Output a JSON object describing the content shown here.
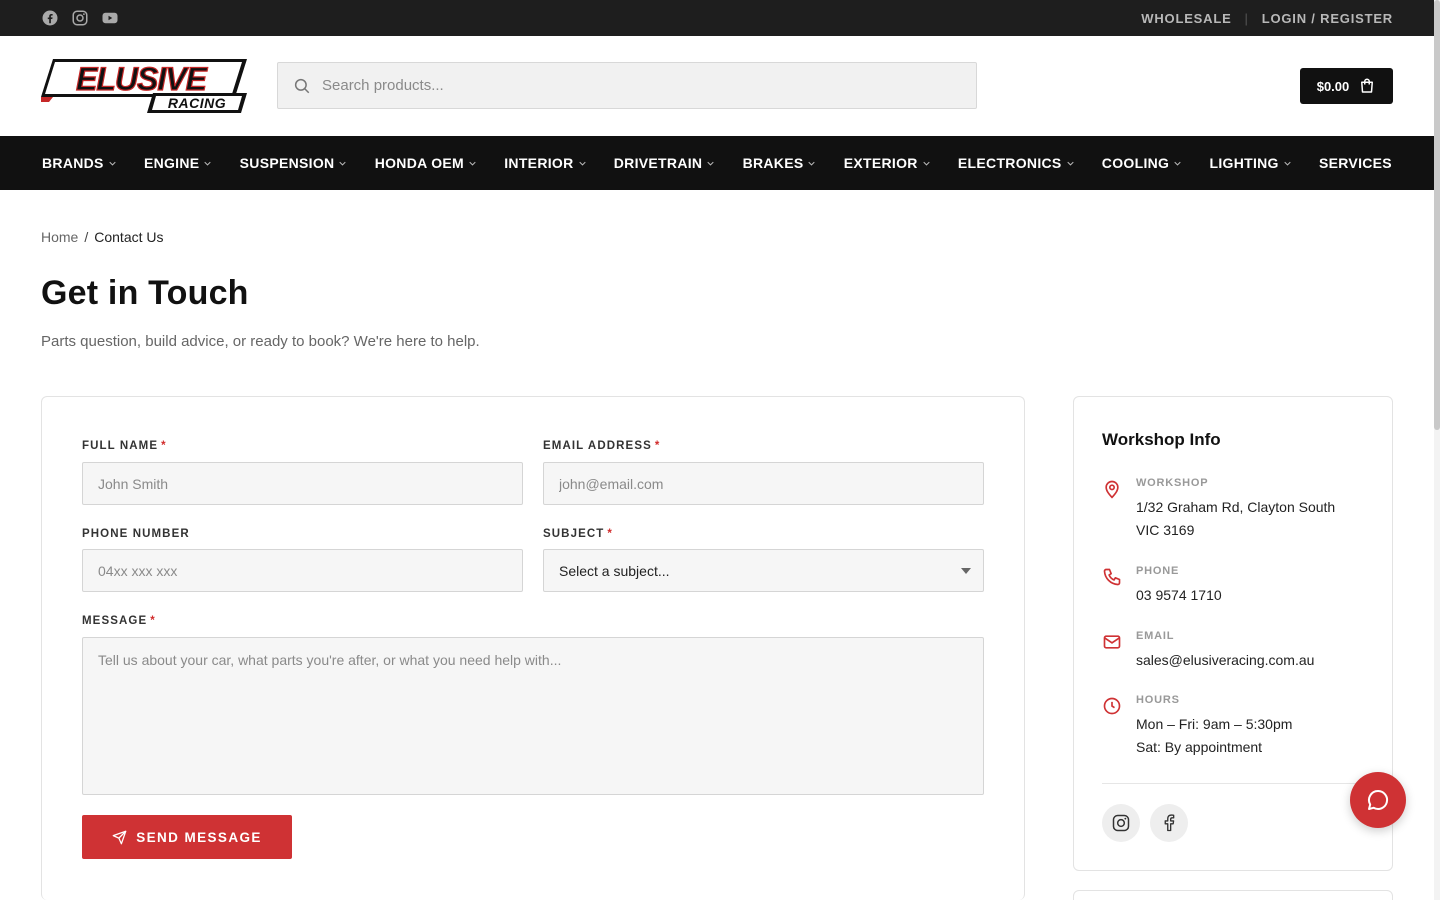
{
  "topbar": {
    "social_icons": [
      "facebook-icon",
      "instagram-icon",
      "youtube-icon"
    ],
    "links": [
      "WHOLESALE",
      "LOGIN / REGISTER"
    ],
    "separator": "|"
  },
  "header": {
    "logo_main": "ELUSIVE",
    "logo_sub": "RACING",
    "search_placeholder": "Search products...",
    "cart_total": "$0.00"
  },
  "nav": {
    "items": [
      {
        "label": "BRANDS",
        "has_dropdown": true
      },
      {
        "label": "ENGINE",
        "has_dropdown": true
      },
      {
        "label": "SUSPENSION",
        "has_dropdown": true
      },
      {
        "label": "HONDA OEM",
        "has_dropdown": true
      },
      {
        "label": "INTERIOR",
        "has_dropdown": true
      },
      {
        "label": "DRIVETRAIN",
        "has_dropdown": true
      },
      {
        "label": "BRAKES",
        "has_dropdown": true
      },
      {
        "label": "EXTERIOR",
        "has_dropdown": true
      },
      {
        "label": "ELECTRONICS",
        "has_dropdown": true
      },
      {
        "label": "COOLING",
        "has_dropdown": true
      },
      {
        "label": "LIGHTING",
        "has_dropdown": true
      },
      {
        "label": "SERVICES",
        "has_dropdown": false
      }
    ]
  },
  "breadcrumb": {
    "home": "Home",
    "separator": "/",
    "current": "Contact Us"
  },
  "page": {
    "title": "Get in Touch",
    "subtitle": "Parts question, build advice, or ready to book? We're here to help."
  },
  "form": {
    "full_name": {
      "label": "FULL NAME",
      "required": "*",
      "placeholder": "John Smith"
    },
    "email": {
      "label": "EMAIL ADDRESS",
      "required": "*",
      "placeholder": "john@email.com"
    },
    "phone": {
      "label": "PHONE NUMBER",
      "placeholder": "04xx xxx xxx"
    },
    "subject": {
      "label": "SUBJECT",
      "required": "*",
      "selected": "Select a subject..."
    },
    "message": {
      "label": "MESSAGE",
      "required": "*",
      "placeholder": "Tell us about your car, what parts you're after, or what you need help with..."
    },
    "submit_label": "SEND MESSAGE"
  },
  "workshop": {
    "title": "Workshop Info",
    "items": [
      {
        "icon": "map-pin-icon",
        "label": "WORKSHOP",
        "lines": [
          "1/32 Graham Rd, Clayton South",
          "VIC 3169"
        ]
      },
      {
        "icon": "phone-icon",
        "label": "PHONE",
        "lines": [
          "03 9574 1710"
        ]
      },
      {
        "icon": "mail-icon",
        "label": "EMAIL",
        "lines": [
          "sales@elusiveracing.com.au"
        ]
      },
      {
        "icon": "clock-icon",
        "label": "HOURS",
        "lines": [
          "Mon – Fri: 9am – 5:30pm",
          "Sat: By appointment"
        ]
      }
    ],
    "social_icons": [
      "instagram-icon",
      "facebook-icon"
    ]
  },
  "colors": {
    "accent": "#cf3234",
    "dark": "#111111",
    "topbar": "#1e1e1e"
  },
  "chat": {
    "icon": "chat-bubble-icon"
  }
}
